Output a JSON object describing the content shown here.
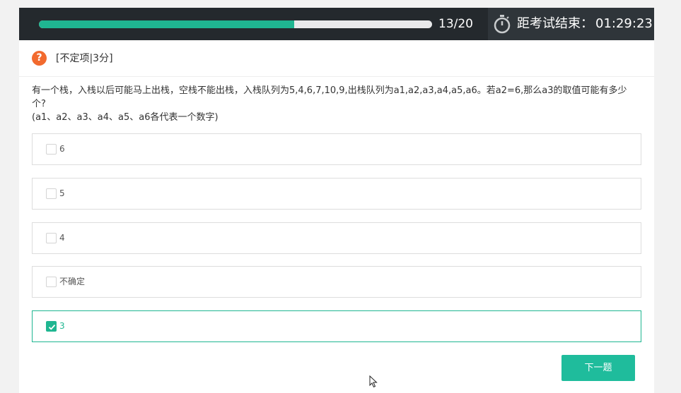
{
  "progress": {
    "count": "13/20",
    "fraction": 0.65
  },
  "timer": {
    "label": "距考试结束：",
    "value": "01:29:23"
  },
  "question": {
    "type_label": "[不定项|3分]",
    "stem_line1": "有一个栈，入栈以后可能马上出栈，空栈不能出栈，入栈队列为5,4,6,7,10,9,出栈队列为a1,a2,a3,a4,a5,a6。若a2=6,那么a3的取值可能有多少个?",
    "stem_line2": "(a1、a2、a3、a4、a5、a6各代表一个数字)"
  },
  "options": [
    {
      "label": "6",
      "checked": false
    },
    {
      "label": "5",
      "checked": false
    },
    {
      "label": "4",
      "checked": false
    },
    {
      "label": "不确定",
      "checked": false
    },
    {
      "label": "3",
      "checked": true
    }
  ],
  "next_button": "下一题",
  "colors": {
    "accent": "#1fb691",
    "dark_bar": "#24292d",
    "question_icon": "#f26a2e"
  }
}
